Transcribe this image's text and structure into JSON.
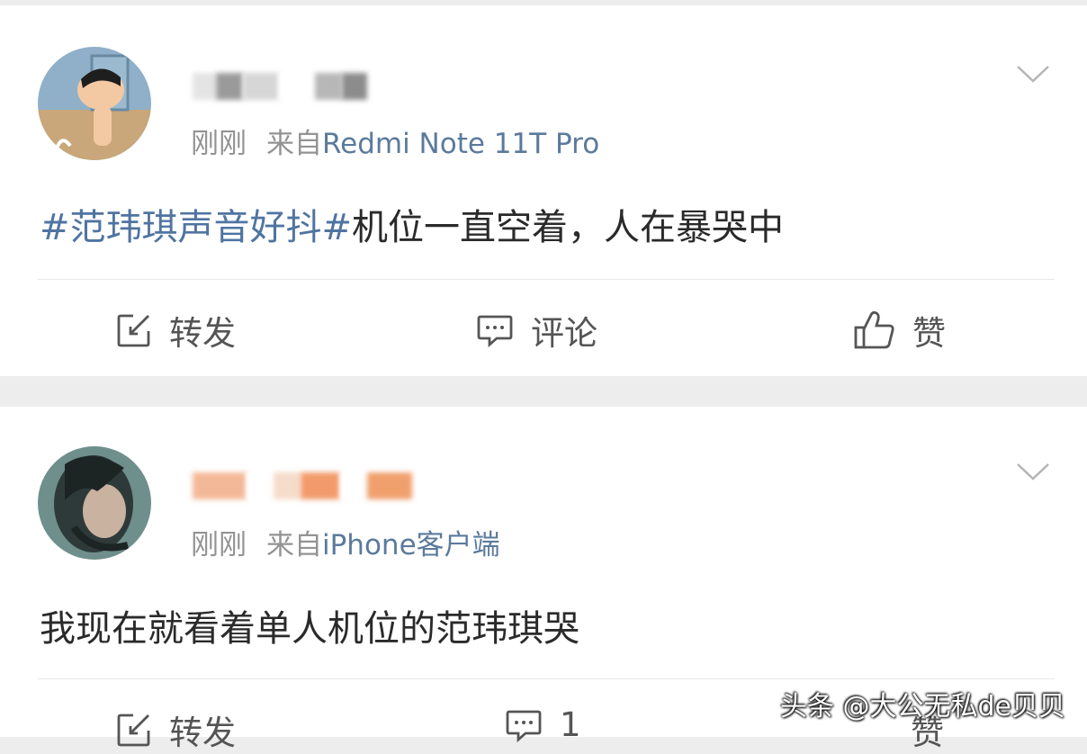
{
  "posts": [
    {
      "time": "刚刚",
      "from_prefix": "来自",
      "source": "Redmi Note 11T Pro",
      "hashtag": "#范玮琪声音好抖#",
      "text": "机位一直空着，人在暴哭中",
      "actions": {
        "repost": "转发",
        "comment": "评论",
        "like": "赞"
      }
    },
    {
      "time": "刚刚",
      "from_prefix": "来自",
      "source": "iPhone客户端",
      "hashtag": "",
      "text": "我现在就看着单人机位的范玮琪哭",
      "actions": {
        "repost": "转发",
        "comment": "1",
        "like": "赞"
      }
    }
  ],
  "watermark": "头条 @大公无私de贝贝",
  "icons": {
    "repost": "edit-square-icon",
    "comment": "comment-bubble-icon",
    "like": "thumbs-up-icon",
    "menu": "chevron-down-icon"
  },
  "colors": {
    "link": "#5b7a9c",
    "hashtag": "#4f74a1",
    "meta": "#939393",
    "text": "#2a2a2a"
  }
}
